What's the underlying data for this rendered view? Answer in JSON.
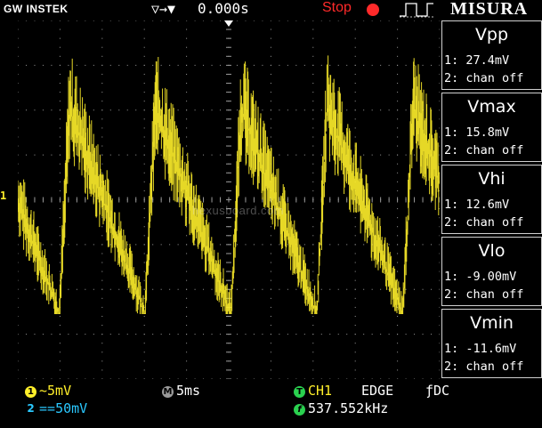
{
  "header": {
    "brand": "GW INSTEK",
    "trigger_marker_glyph": "▽→▼",
    "delay": "0.000s",
    "run_state": "Stop",
    "panel_title": "MISURA",
    "trigger_icon": "rising-edge-trigger-icon"
  },
  "screen": {
    "ch1_marker": "1",
    "watermark": "hexusboard.com",
    "colors": {
      "trace": "#ffef2a",
      "grid": "#9a9a9a",
      "ch2": "#2ac8ff"
    }
  },
  "measurements": [
    {
      "title": "Vpp",
      "ch1": "1: 27.4mV",
      "ch2": "2: chan off"
    },
    {
      "title": "Vmax",
      "ch1": "1: 15.8mV",
      "ch2": "2: chan off"
    },
    {
      "title": "Vhi",
      "ch1": "1: 12.6mV",
      "ch2": "2: chan off"
    },
    {
      "title": "Vlo",
      "ch1": "1: -9.00mV",
      "ch2": "2: chan off"
    },
    {
      "title": "Vmin",
      "ch1": "1: -11.6mV",
      "ch2": "2: chan off"
    }
  ],
  "footer": {
    "ch1_badge": "1",
    "ch1_coupling": "~",
    "ch1_scale": "5mV",
    "ch2_badge": "2",
    "ch2_coupling": "==",
    "ch2_scale": "50mV",
    "time_badge": "M",
    "time_scale": "5ms",
    "trig_badge": "T",
    "trig_source": "CH1",
    "trig_type": "EDGE",
    "trig_coupling": "ƒDC",
    "freq_badge": "f",
    "frequency": "537.552kHz"
  }
}
